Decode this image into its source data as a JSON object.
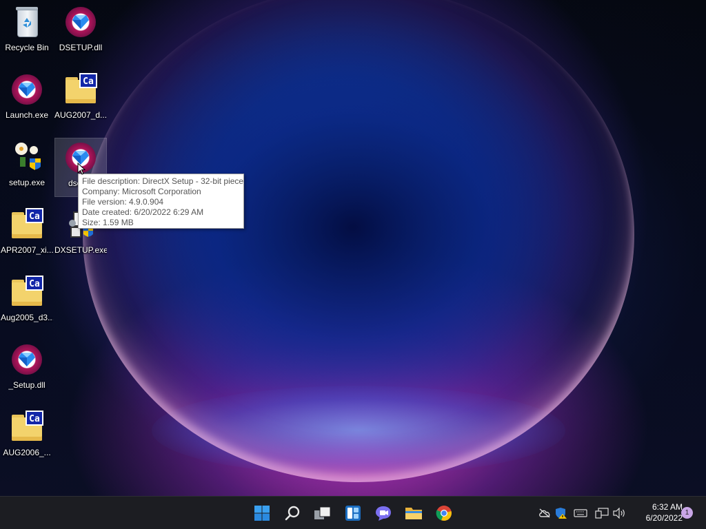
{
  "desktop": {
    "icons": [
      {
        "label": "Recycle Bin",
        "type": "recycle-bin"
      },
      {
        "label": "DSETUP.dll",
        "type": "gem"
      },
      {
        "label": "Launch.exe",
        "type": "gem"
      },
      {
        "label": "AUG2007_d...",
        "type": "folder"
      },
      {
        "label": "setup.exe",
        "type": "setup"
      },
      {
        "label": "dsetup",
        "type": "gem",
        "selected": true
      },
      {
        "label": "APR2007_xi...",
        "type": "folder"
      },
      {
        "label": "DXSETUP.exe",
        "type": "setup"
      },
      {
        "label": "Aug2005_d3...",
        "type": "folder"
      },
      {
        "label": "_Setup.dll",
        "type": "gem"
      },
      {
        "label": "AUG2006_...",
        "type": "folder"
      }
    ],
    "folder_badge": "Ca"
  },
  "tooltip": {
    "description": "File description: DirectX Setup - 32-bit piece",
    "company": "Company: Microsoft Corporation",
    "version": "File version: 4.9.0.904",
    "created": "Date created: 6/20/2022 6:29 AM",
    "size": "Size: 1.59 MB"
  },
  "taskbar": {
    "apps": [
      {
        "name": "start",
        "icon": "windows-logo-icon"
      },
      {
        "name": "search",
        "icon": "search-icon"
      },
      {
        "name": "task-view",
        "icon": "task-view-icon"
      },
      {
        "name": "widgets",
        "icon": "widgets-icon"
      },
      {
        "name": "chat",
        "icon": "chat-icon"
      },
      {
        "name": "file-explorer",
        "icon": "folder-icon"
      },
      {
        "name": "chrome",
        "icon": "chrome-icon"
      }
    ],
    "tray": [
      "onedrive-off-icon",
      "security-warning-icon",
      "keyboard-icon",
      "network-icon",
      "volume-icon"
    ],
    "clock": {
      "time": "6:32 AM",
      "date": "6/20/2022"
    },
    "notification_count": "1"
  },
  "colors": {
    "taskbar": "#1c1d22",
    "accent": "#0078d4",
    "folder": "#f3d36c",
    "ca_badge": "#1226a8"
  }
}
